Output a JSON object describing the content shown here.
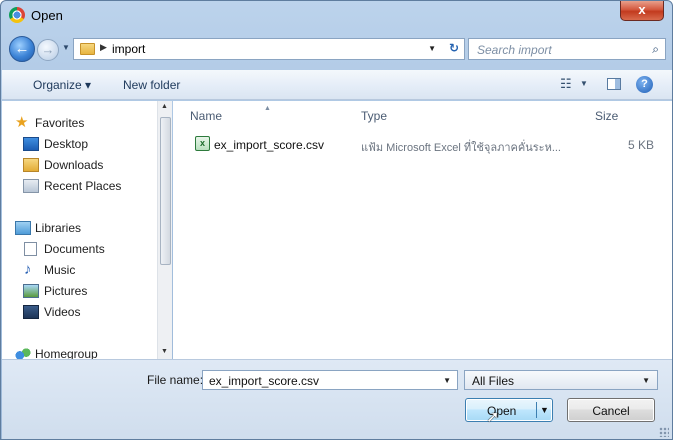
{
  "window": {
    "title": "Open",
    "close_glyph": "x"
  },
  "address": {
    "path": [
      "import"
    ],
    "search_placeholder": "Search import"
  },
  "toolbar": {
    "organize": "Organize ▾",
    "new_folder": "New folder"
  },
  "nav": {
    "favorites": {
      "label": "Favorites",
      "items": [
        "Desktop",
        "Downloads",
        "Recent Places"
      ]
    },
    "libraries": {
      "label": "Libraries",
      "items": [
        "Documents",
        "Music",
        "Pictures",
        "Videos"
      ]
    },
    "homegroup": "Homegroup"
  },
  "columns": {
    "name": "Name",
    "type": "Type",
    "size": "Size"
  },
  "files": [
    {
      "name": "ex_import_score.csv",
      "type": "แฟ้ม Microsoft Excel ที่ใช้จุลภาคคั่นระห...",
      "size": "5 KB",
      "icon": "excel-csv-icon"
    }
  ],
  "bottom": {
    "file_name_label": "File name:",
    "file_name_value": "ex_import_score.csv",
    "file_type": "All Files",
    "open": "Open",
    "cancel": "Cancel"
  },
  "colors": {
    "accent": "#3c7fb1",
    "close": "#c23a1e",
    "chrome": "#a6c1df"
  }
}
